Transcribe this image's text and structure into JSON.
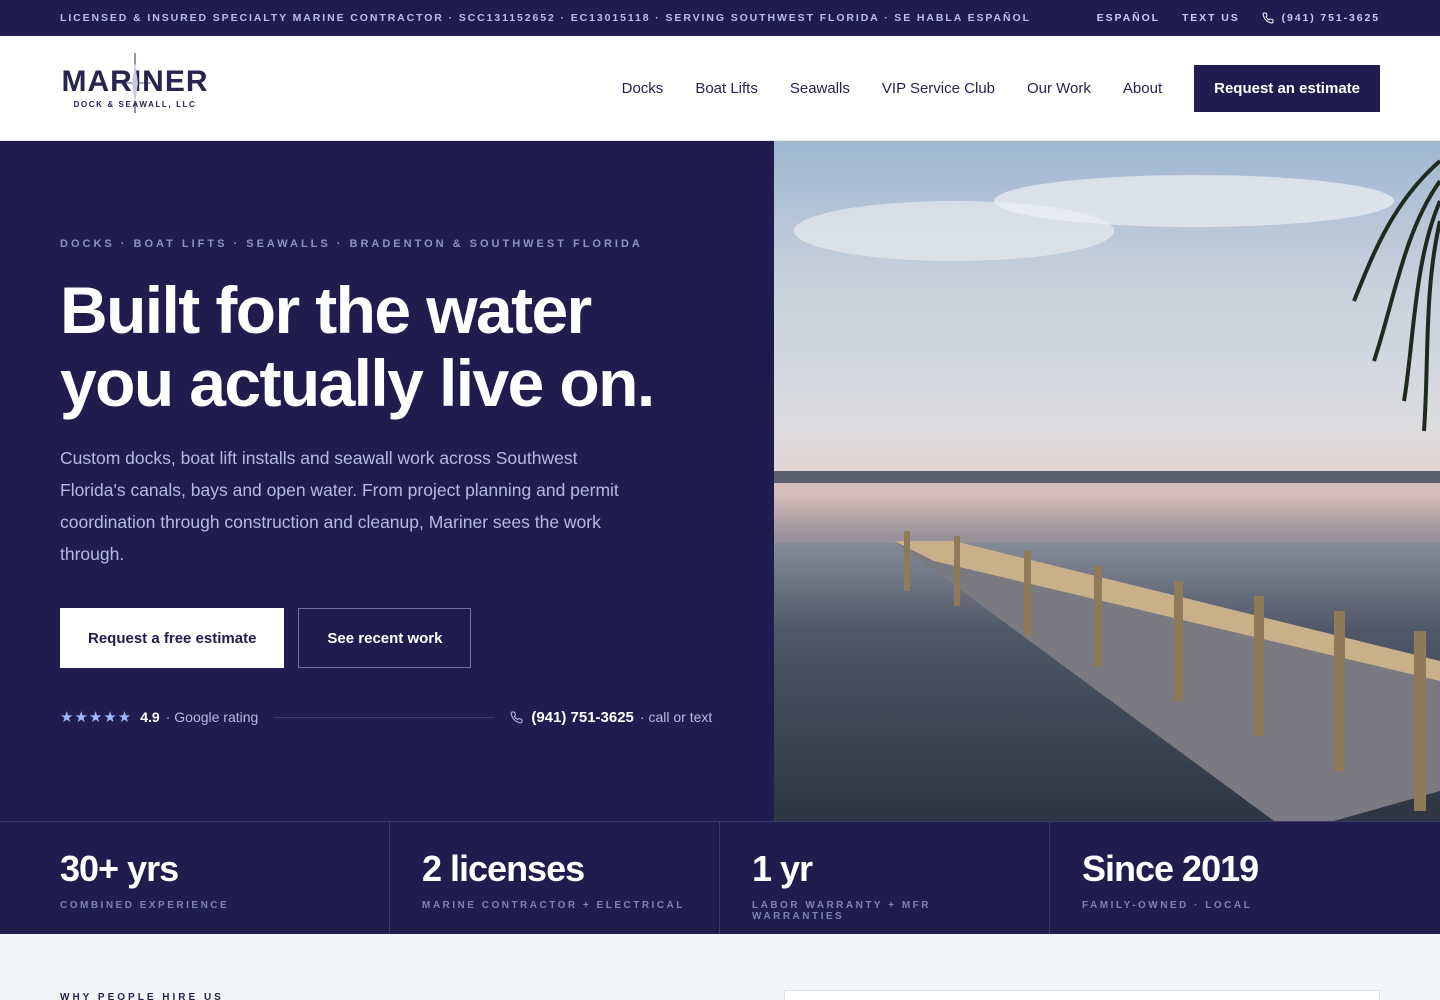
{
  "topbar": {
    "info": "LICENSED & INSURED SPECIALTY MARINE CONTRACTOR · SCC131152652 · EC13015118 · SERVING SOUTHWEST FLORIDA · SE HABLA ESPAÑOL",
    "espanol": "ESPAÑOL",
    "text_us": "TEXT US",
    "phone": "(941) 751-3625"
  },
  "header": {
    "logo_word": "MARINER",
    "logo_sub": "DOCK & SEAWALL, LLC",
    "nav": [
      "Docks",
      "Boat Lifts",
      "Seawalls",
      "VIP Service Club",
      "Our Work",
      "About"
    ],
    "cta": "Request an estimate"
  },
  "hero": {
    "eyebrow": "DOCKS · BOAT LIFTS · SEAWALLS · BRADENTON & SOUTHWEST FLORIDA",
    "headline_line1": "Built for the water",
    "headline_line2": "you actually live on.",
    "lede": "Custom docks, boat lift installs and seawall work across Southwest Florida's canals, bays and open water. From project planning and permit coordination through construction and cleanup, Mariner sees the work through.",
    "primary_button": "Request a free estimate",
    "secondary_button": "See recent work",
    "stars": "★★★★★",
    "rating": "4.9",
    "rating_label": "· Google rating",
    "phone": "(941) 751-3625",
    "phone_label": "· call or text"
  },
  "stats": [
    {
      "value": "30+ yrs",
      "label": "COMBINED EXPERIENCE"
    },
    {
      "value": "2 licenses",
      "label": "MARINE CONTRACTOR + ELECTRICAL"
    },
    {
      "value": "1 yr",
      "label": "LABOR WARRANTY + MFR WARRANTIES"
    },
    {
      "value": "Since 2019",
      "label": "FAMILY-OWNED · LOCAL"
    }
  ],
  "next_section": {
    "eyebrow": "WHY PEOPLE HIRE US"
  },
  "colors": {
    "navy": "#201c4d",
    "white": "#ffffff",
    "accent_star": "#9fb8ff"
  }
}
